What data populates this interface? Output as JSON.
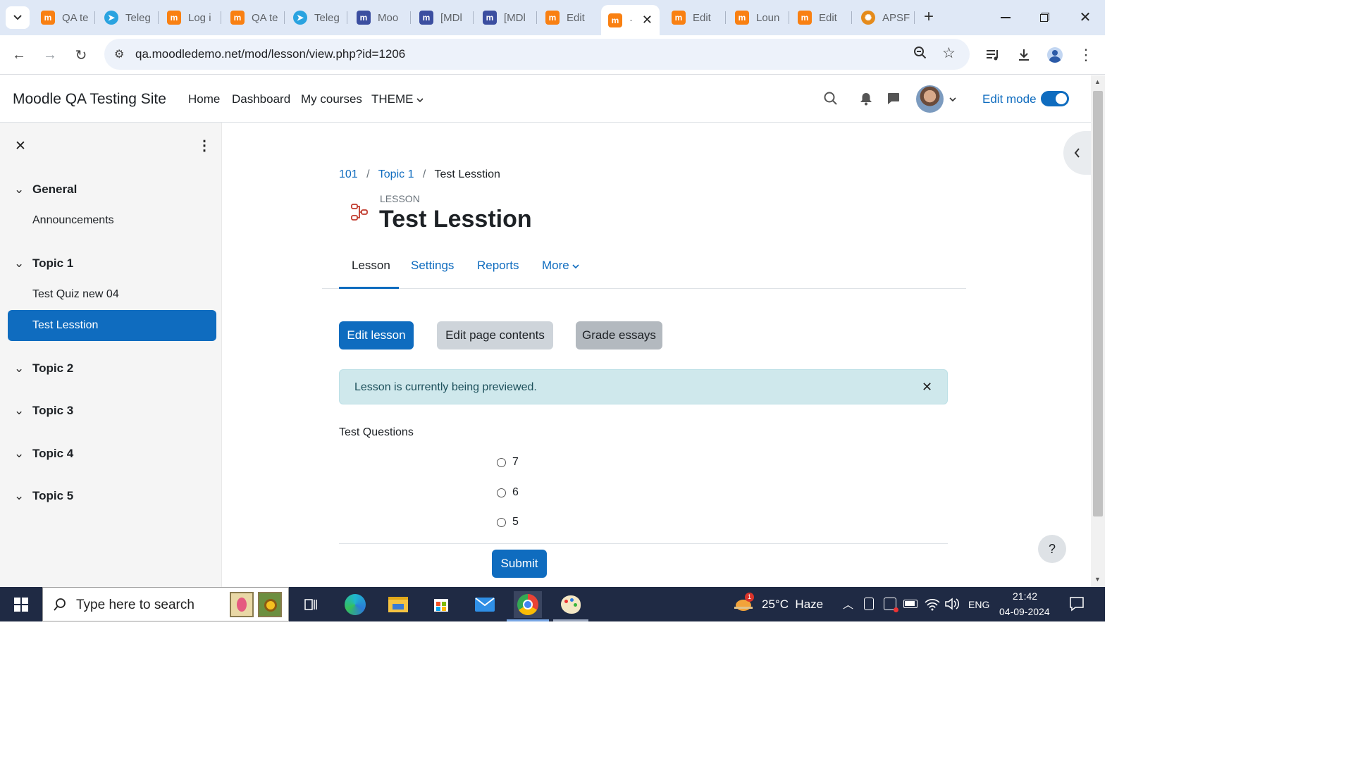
{
  "browser": {
    "tabs": [
      {
        "label": "QA te",
        "icon": "moodle-icon"
      },
      {
        "label": "Teleg",
        "icon": "telegram-icon"
      },
      {
        "label": "Log i",
        "icon": "moodle-icon"
      },
      {
        "label": "QA te",
        "icon": "moodle-icon"
      },
      {
        "label": "Teleg",
        "icon": "telegram-icon"
      },
      {
        "label": "Moo",
        "icon": "moodle-tracker-icon"
      },
      {
        "label": "[MDl",
        "icon": "moodle-tracker-icon"
      },
      {
        "label": "[MDl",
        "icon": "moodle-tracker-icon"
      },
      {
        "label": "Edit",
        "icon": "moodle-icon"
      },
      {
        "label": "·",
        "icon": "moodle-icon"
      },
      {
        "label": "Edit",
        "icon": "moodle-icon"
      },
      {
        "label": "Loun",
        "icon": "moodle-icon"
      },
      {
        "label": "Edit",
        "icon": "moodle-icon"
      },
      {
        "label": "APSF",
        "icon": "apsf-icon"
      }
    ],
    "new_tab": "+",
    "url": "qa.moodledemo.net/mod/lesson/view.php?id=1206"
  },
  "header": {
    "site_name": "Moodle QA Testing Site",
    "nav": [
      "Home",
      "Dashboard",
      "My courses",
      "THEME"
    ],
    "edit_mode_label": "Edit mode",
    "edit_mode_on": true
  },
  "drawer": {
    "sections": [
      {
        "title": "General",
        "items": [
          "Announcements"
        ]
      },
      {
        "title": "Topic 1",
        "items": [
          "Test Quiz new 04",
          "Test Lesstion"
        ]
      },
      {
        "title": "Topic 2",
        "items": []
      },
      {
        "title": "Topic 3",
        "items": []
      },
      {
        "title": "Topic 4",
        "items": []
      },
      {
        "title": "Topic 5",
        "items": []
      }
    ],
    "active_item": "Test Lesstion"
  },
  "main": {
    "breadcrumb": [
      "101",
      "Topic 1",
      "Test Lesstion"
    ],
    "activity_type": "LESSON",
    "title": "Test Lesstion",
    "tabs": [
      "Lesson",
      "Settings",
      "Reports",
      "More"
    ],
    "active_tab": "Lesson",
    "buttons": {
      "edit_lesson": "Edit lesson",
      "edit_page_contents": "Edit page contents",
      "grade_essays": "Grade essays"
    },
    "alert": "Lesson is currently being previewed.",
    "question_title": "Test Questions",
    "options": [
      "7",
      "6",
      "5"
    ],
    "submit": "Submit"
  },
  "help_button": "?",
  "taskbar": {
    "search_placeholder": "Type here to search",
    "weather": "25°C  Haze",
    "weather_badge": "1",
    "lang": "ENG",
    "time": "21:42",
    "date": "04-09-2024"
  },
  "colors": {
    "primary": "#0f6cbf",
    "alert_bg": "#cfe8ec",
    "drawer_bg": "#f5f5f5",
    "tabstrip": "#dfe8f6"
  }
}
